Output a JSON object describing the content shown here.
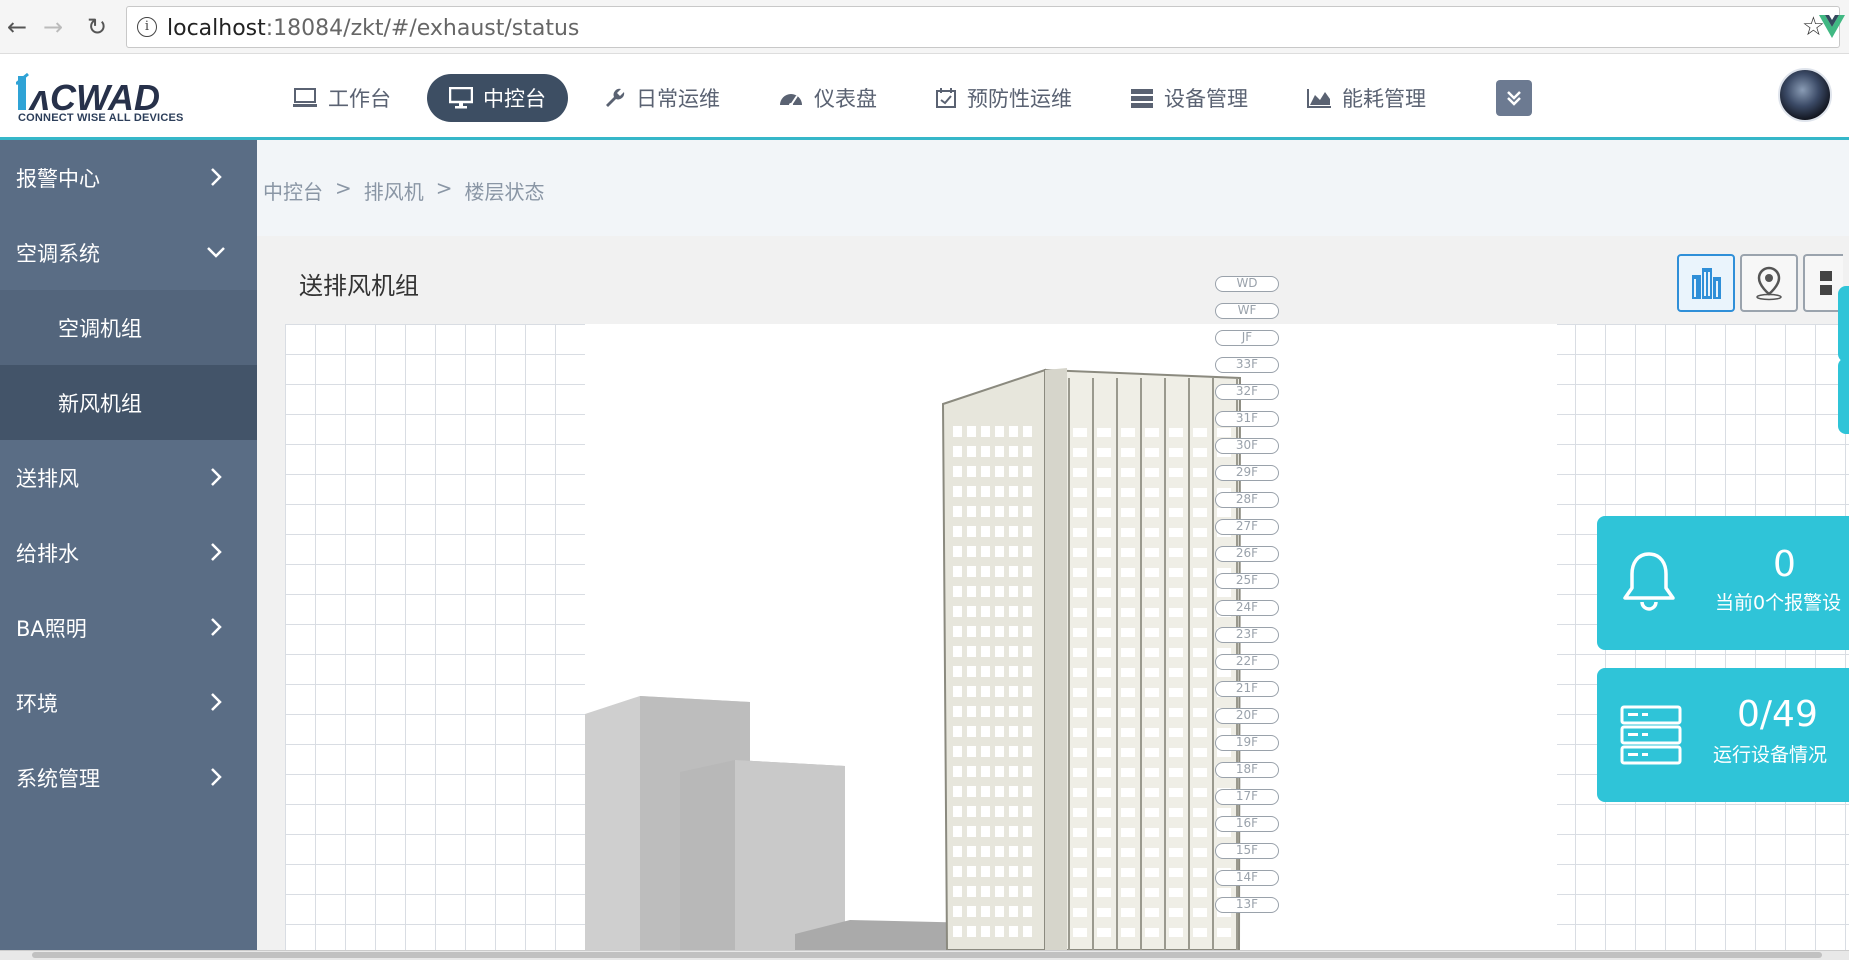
{
  "browser": {
    "url_host": "localhost",
    "url_rest": ":18084/zkt/#/exhaust/status"
  },
  "logo": {
    "subtitle": "CONNECT WISE ALL DEVICES"
  },
  "top_nav": [
    {
      "label": "工作台",
      "icon": "monitor-outline-icon",
      "active": false
    },
    {
      "label": "中控台",
      "icon": "desktop-icon",
      "active": true
    },
    {
      "label": "日常运维",
      "icon": "wrench-icon",
      "active": false
    },
    {
      "label": "仪表盘",
      "icon": "dashboard-gauge-icon",
      "active": false
    },
    {
      "label": "预防性运维",
      "icon": "calendar-check-icon",
      "active": false
    },
    {
      "label": "设备管理",
      "icon": "server-list-icon",
      "active": false
    },
    {
      "label": "能耗管理",
      "icon": "area-chart-icon",
      "active": false
    }
  ],
  "sidebar": {
    "items": [
      {
        "label": "报警中心",
        "chevron": "right"
      },
      {
        "label": "空调系统",
        "chevron": "down"
      },
      {
        "label": "空调机组",
        "sub": true,
        "active": false
      },
      {
        "label": "新风机组",
        "sub": true,
        "active": true
      },
      {
        "label": "送排风",
        "chevron": "right"
      },
      {
        "label": "给排水",
        "chevron": "right"
      },
      {
        "label": "BA照明",
        "chevron": "right"
      },
      {
        "label": "环境",
        "chevron": "right"
      },
      {
        "label": "系统管理",
        "chevron": "right"
      }
    ]
  },
  "breadcrumb": [
    "中控台",
    ">",
    "排风机",
    ">",
    "楼层状态"
  ],
  "panel": {
    "title": "送排风机组"
  },
  "floors": [
    "WD",
    "WF",
    "JF",
    "33F",
    "32F",
    "31F",
    "30F",
    "29F",
    "28F",
    "27F",
    "26F",
    "25F",
    "24F",
    "23F",
    "22F",
    "21F",
    "20F",
    "19F",
    "18F",
    "17F",
    "16F",
    "15F",
    "14F",
    "13F"
  ],
  "stats": {
    "alarm": {
      "value": "0",
      "label": "当前0个报警设"
    },
    "devices": {
      "value": "0/49",
      "label": "运行设备情况"
    }
  },
  "colors": {
    "accent": "#35b7c9",
    "sidebar": "#5a6d85",
    "card": "#2fc4d8",
    "nav_active": "#3d4e63"
  }
}
